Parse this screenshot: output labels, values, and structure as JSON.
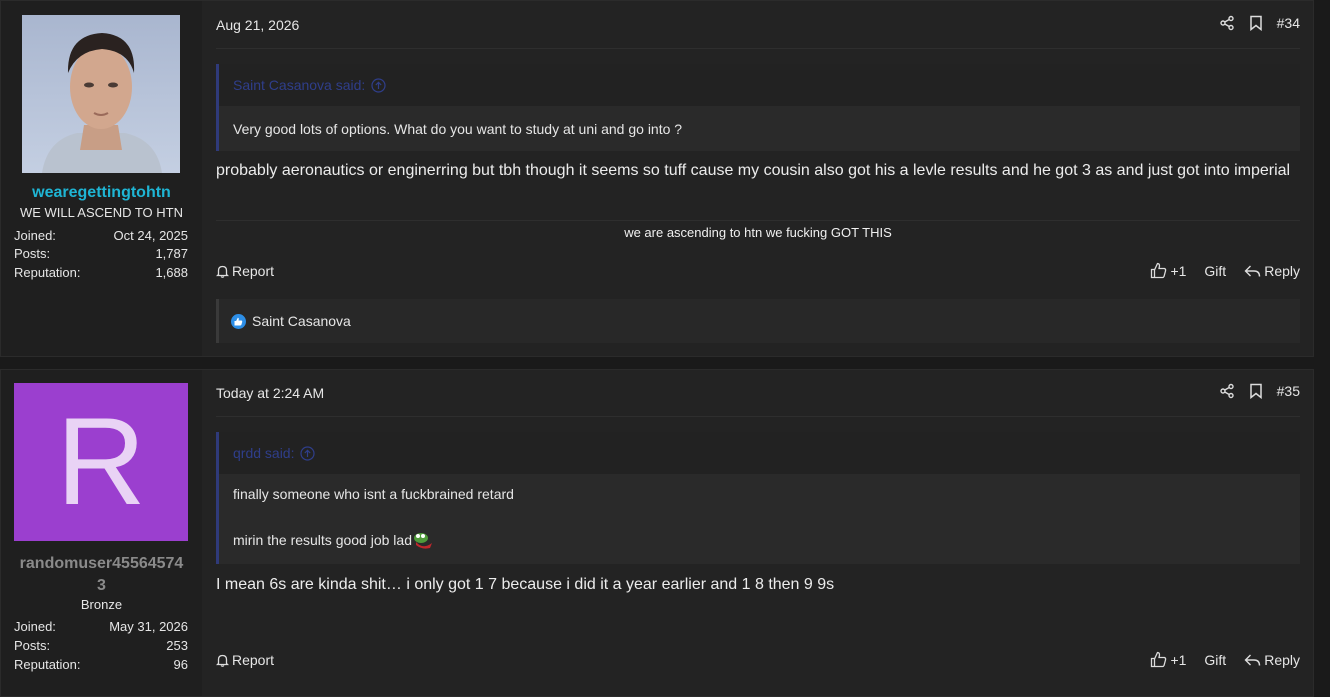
{
  "posts": [
    {
      "user": {
        "name": "wearegettingtohtn",
        "name_color": "#1fb5d4",
        "title": "WE WILL ASCEND TO HTN",
        "stats": [
          {
            "label": "Joined:",
            "value": "Oct 24, 2025"
          },
          {
            "label": "Posts:",
            "value": "1,787"
          },
          {
            "label": "Reputation:",
            "value": "1,688"
          }
        ]
      },
      "date": "Aug 21, 2026",
      "post_number": "#34",
      "quote": {
        "author": "Saint Casanova said:",
        "lines": [
          "Very good lots of options. What do you want to study at uni and go into ?"
        ]
      },
      "message": "probably aeronautics or enginerring but tbh though it seems so tuff cause my cousin also got his a levle results and he got 3 as and just got into imperial",
      "signature": "we are ascending to htn we fucking GOT THIS",
      "actions": {
        "report": "Report",
        "like": "+1",
        "gift": "Gift",
        "reply": "Reply"
      },
      "reactions": {
        "text": "Saint Casanova",
        "icon": "like-reaction-icon"
      }
    },
    {
      "user": {
        "name_line1": "randomuser45564574",
        "name_line2": "3",
        "name_color": "#8a8a8a",
        "avatar_letter": "R",
        "avatar_color": "#9b3fcf",
        "title": "Bronze",
        "stats": [
          {
            "label": "Joined:",
            "value": "May 31, 2026"
          },
          {
            "label": "Posts:",
            "value": "253"
          },
          {
            "label": "Reputation:",
            "value": "96"
          }
        ]
      },
      "date": "Today at 2:24 AM",
      "post_number": "#35",
      "quote": {
        "author": "qrdd said:",
        "lines": [
          "finally someone who isnt a fuckbrained retard",
          "mirin the results good job lad"
        ]
      },
      "message": "I mean 6s are kinda shit… i only got 1 7 because i did it a year earlier and 1 8 then 9 9s",
      "actions": {
        "report": "Report",
        "like": "+1",
        "gift": "Gift",
        "reply": "Reply"
      }
    }
  ]
}
